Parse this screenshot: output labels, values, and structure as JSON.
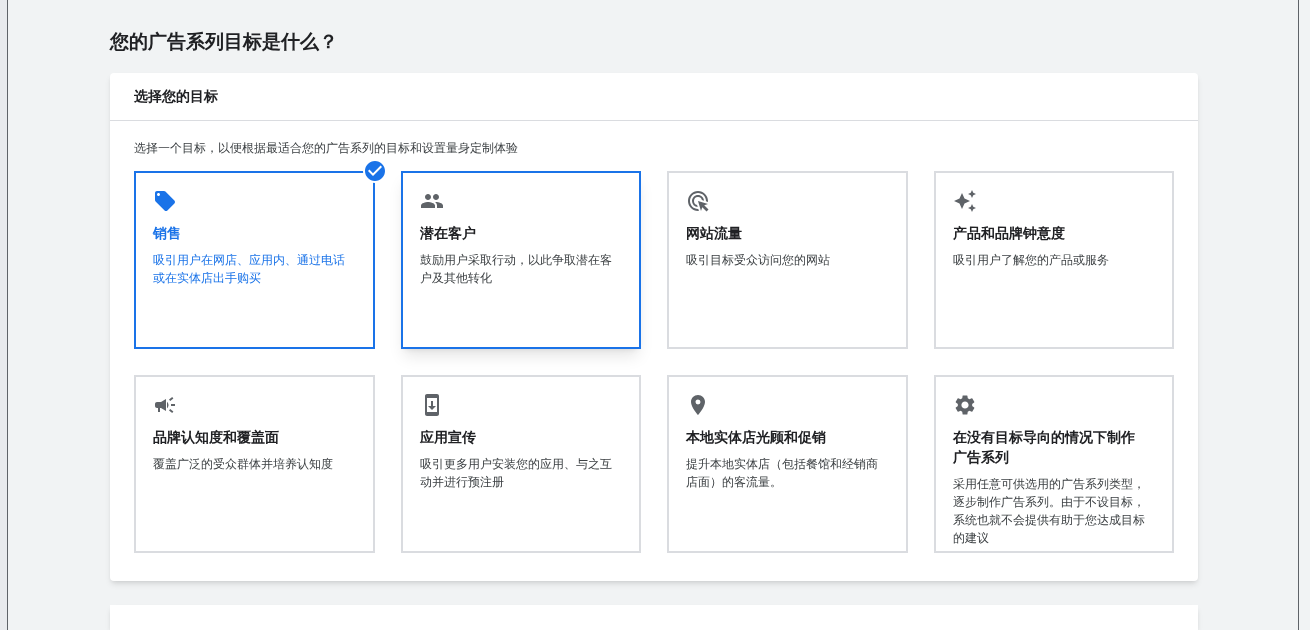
{
  "page_title": "您的广告系列目标是什么？",
  "panel": {
    "header": "选择您的目标",
    "instruction": "选择一个目标，以便根据最适合您的广告系列的目标和设置量身定制体验",
    "goals": [
      {
        "title": "销售",
        "description": "吸引用户在网店、应用内、通过电话或在实体店出手购买",
        "selected": true,
        "hovered": false
      },
      {
        "title": "潜在客户",
        "description": "鼓励用户采取行动，以此争取潜在客户及其他转化",
        "selected": false,
        "hovered": true
      },
      {
        "title": "网站流量",
        "description": "吸引目标受众访问您的网站",
        "selected": false,
        "hovered": false
      },
      {
        "title": "产品和品牌钟意度",
        "description": "吸引用户了解您的产品或服务",
        "selected": false,
        "hovered": false
      },
      {
        "title": "品牌认知度和覆盖面",
        "description": "覆盖广泛的受众群体并培养认知度",
        "selected": false,
        "hovered": false
      },
      {
        "title": "应用宣传",
        "description": "吸引更多用户安装您的应用、与之互动并进行预注册",
        "selected": false,
        "hovered": false
      },
      {
        "title": "本地实体店光顾和促销",
        "description": "提升本地实体店（包括餐馆和经销商店面）的客流量。",
        "selected": false,
        "hovered": false
      },
      {
        "title": "在没有目标导向的情况下制作广告系列",
        "description": "采用任意可供选用的广告系列类型，逐步制作广告系列。由于不设目标，系统也就不会提供有助于您达成目标的建议",
        "selected": false,
        "hovered": false
      }
    ]
  }
}
